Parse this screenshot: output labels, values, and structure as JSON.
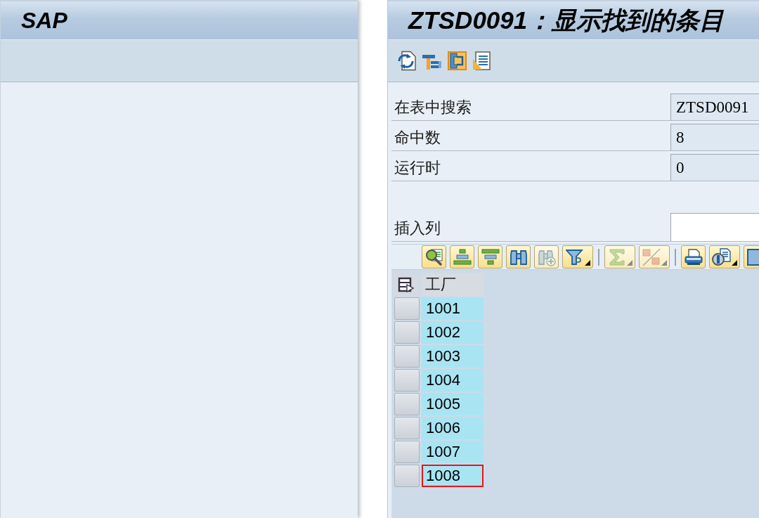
{
  "left_panel": {
    "title": "SAP"
  },
  "window": {
    "title": "ZTSD0091：显示找到的条目"
  },
  "form": {
    "fields": [
      {
        "kind": "display",
        "label": "在表中搜索",
        "value": "ZTSD0091"
      },
      {
        "kind": "display",
        "label": "命中数",
        "value": "8"
      },
      {
        "kind": "display",
        "label": "运行时",
        "value": "0"
      },
      {
        "kind": "input",
        "label": "插入列"
      }
    ]
  },
  "alv_toolbar": {
    "groups": [
      {
        "buttons": [
          {
            "disabled": false,
            "menu": false
          },
          {
            "disabled": false,
            "menu": false
          },
          {
            "disabled": false,
            "menu": false
          },
          {
            "disabled": false,
            "menu": false
          },
          {
            "disabled": true,
            "menu": false
          },
          {
            "disabled": false,
            "menu": true
          }
        ]
      },
      {
        "buttons": [
          {
            "disabled": true,
            "menu": true
          },
          {
            "disabled": true,
            "menu": true
          }
        ]
      },
      {
        "buttons": [
          {
            "disabled": false,
            "menu": false
          },
          {
            "disabled": false,
            "menu": true
          },
          {
            "disabled": false,
            "menu": false
          }
        ]
      }
    ]
  },
  "table": {
    "columns": [
      "工厂"
    ],
    "rows": [
      {
        "cells": [
          "1001"
        ],
        "marked": false
      },
      {
        "cells": [
          "1002"
        ],
        "marked": false
      },
      {
        "cells": [
          "1003"
        ],
        "marked": false
      },
      {
        "cells": [
          "1004"
        ],
        "marked": false
      },
      {
        "cells": [
          "1005"
        ],
        "marked": false
      },
      {
        "cells": [
          "1006"
        ],
        "marked": false
      },
      {
        "cells": [
          "1007"
        ],
        "marked": false
      },
      {
        "cells": [
          "1008"
        ],
        "marked": true
      }
    ]
  }
}
